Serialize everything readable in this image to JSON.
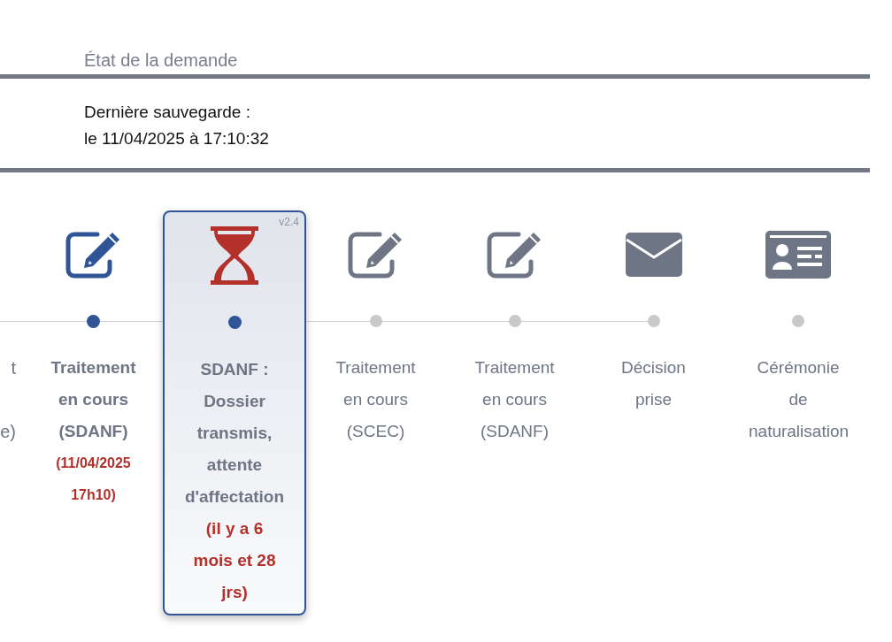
{
  "section_title": "État de la demande",
  "last_save": {
    "label": "Dernière sauvegarde :",
    "value": "le 11/04/2025 à 17:10:32"
  },
  "partial_step": {
    "label_top": "t",
    "label_bottom": "e)"
  },
  "steps": [
    {
      "kind": "edit",
      "completed": true,
      "label": "Traitement en cours (SDANF)",
      "date": "(11/04/2025 17h10)",
      "selected": false
    },
    {
      "kind": "hourglass",
      "completed": true,
      "label": "SDANF : Dossier transmis, attente d'affectation",
      "date": "(il y a 6 mois et 28 jrs)",
      "version": "v2.4",
      "selected": true
    },
    {
      "kind": "edit",
      "completed": false,
      "label": "Traitement en cours (SCEC)",
      "selected": false
    },
    {
      "kind": "edit",
      "completed": false,
      "label": "Traitement en cours (SDANF)",
      "selected": false
    },
    {
      "kind": "envelope",
      "completed": false,
      "label": "Décision prise",
      "selected": false
    },
    {
      "kind": "id-card",
      "completed": false,
      "label": "Cérémonie de naturalisation",
      "selected": false
    }
  ]
}
